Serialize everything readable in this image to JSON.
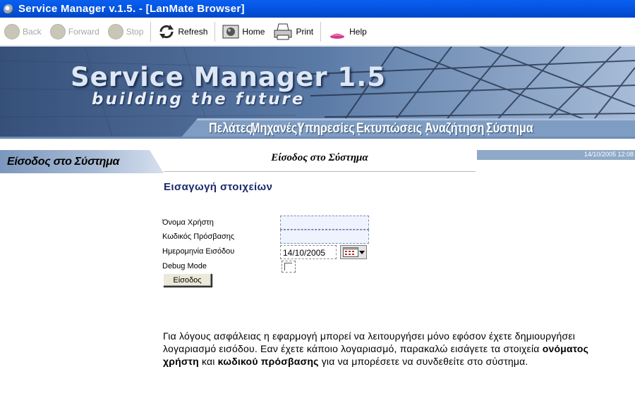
{
  "window": {
    "title": "Service Manager v.1.5. - [LanMate Browser]"
  },
  "toolbar": {
    "back": "Back",
    "forward": "Forward",
    "stop": "Stop",
    "refresh": "Refresh",
    "home": "Home",
    "print": "Print",
    "help": "Help"
  },
  "banner": {
    "title": "Service Manager 1.5",
    "subtitle": "building the future"
  },
  "nav": {
    "items": [
      {
        "label": "Πελάτες"
      },
      {
        "label": "Μηχανές"
      },
      {
        "label": "Υπηρεσίες"
      },
      {
        "label": "Εκτυπώσεις"
      },
      {
        "label": "Αναζήτηση"
      },
      {
        "label": "Σύστημα"
      }
    ],
    "separator": "|"
  },
  "sidebar": {
    "label": "Είσοδος στο Σύστημα"
  },
  "header": {
    "datetime": "14/10/2005 12:08"
  },
  "content": {
    "title": "Είσοδος στο Σύστημα",
    "section_heading": "Εισαγωγή στοιχείων"
  },
  "form": {
    "username_label": "Όνομα Χρήστη",
    "username_value": "",
    "password_label": "Κωδικός Πρόσβασης",
    "password_value": "",
    "date_label": "Ημερομηνία Εισόδου",
    "date_value": "14/10/2005",
    "debug_label": "Debug Mode",
    "debug_checked": false,
    "submit_label": "Είσοδος"
  },
  "info": {
    "part1": "Για λόγους ασφάλειας η εφαρμογή μπορεί να λειτουργήσει μόνο εφόσον έχετε δημιουργήσει λογαριασμό εισόδου. Εαν έχετε κάποιο λογαριασμό, παρακαλώ εισάγετε τα στοιχεία ",
    "bold1": "ονόματος χρήστη",
    "part2": " και ",
    "bold2": "κωδικού πρόσβασης",
    "part3": " για να μπορέσετε να συνδεθείτε στο σύστημα."
  },
  "colors": {
    "titlebar": "#0556e4",
    "banner": "#4a6892",
    "section_heading": "#1a2a6c",
    "input_bg": "#eef3fd"
  }
}
